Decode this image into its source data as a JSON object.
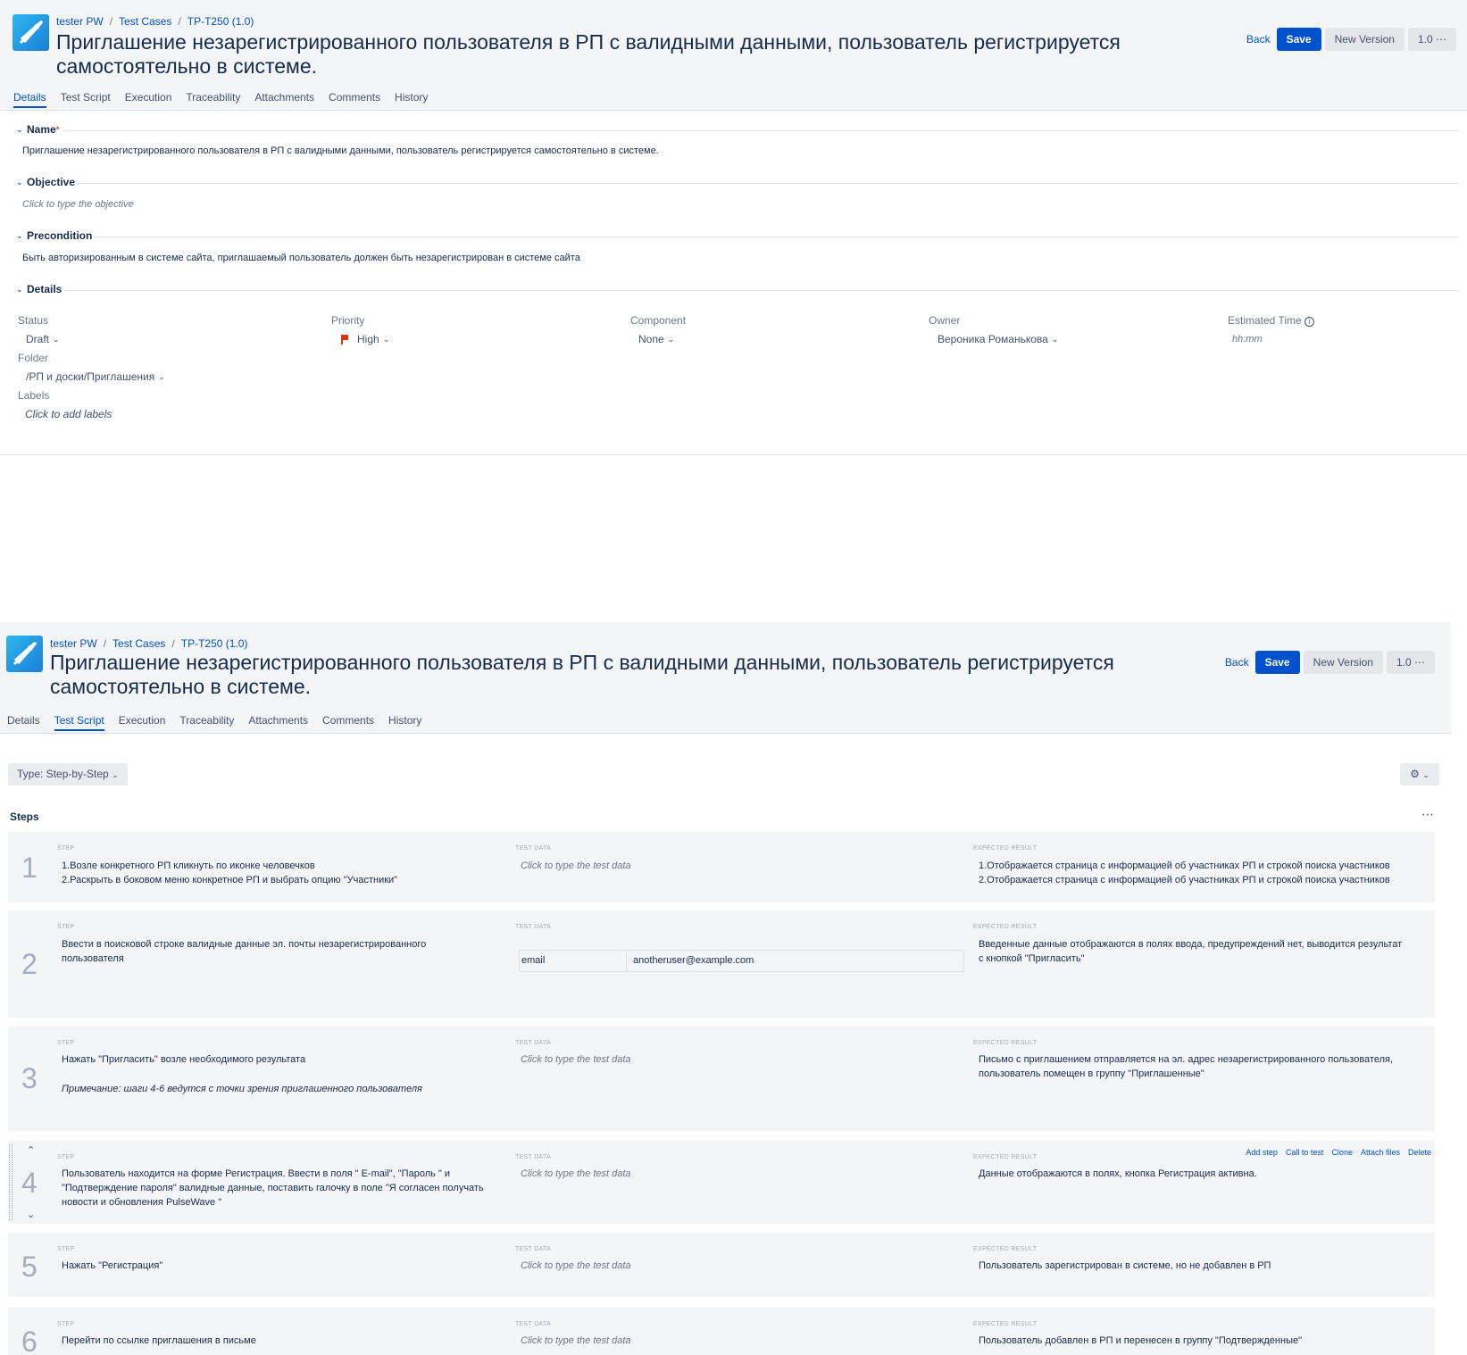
{
  "breadcrumb": {
    "project": "tester PW",
    "section": "Test Cases",
    "key": "TP-T250 (1.0)"
  },
  "title": "Приглашение незарегистрированного пользователя в РП с валидными данными, пользователь регистрируется самостоятельно в системе.",
  "actions": {
    "back": "Back",
    "save": "Save",
    "new_version": "New Version",
    "version": "1.0 ⋯"
  },
  "tabs": [
    "Details",
    "Test Script",
    "Execution",
    "Traceability",
    "Attachments",
    "Comments",
    "History"
  ],
  "details": {
    "name_label": "Name",
    "name_value": "Приглашение  незарегистрированного пользователя в РП с валидными данными, пользователь регистрируется самостоятельно в системе.",
    "objective_label": "Objective",
    "objective_placeholder": "Click to type the objective",
    "precondition_label": "Precondition",
    "precondition_value": "Быть авторизированным в системе сайта, приглашаемый пользователь должен быть незарегистрирован в системе сайта",
    "details_label": "Details",
    "fields": {
      "status_label": "Status",
      "status_value": "Draft",
      "priority_label": "Priority",
      "priority_value": "High",
      "component_label": "Component",
      "component_value": "None",
      "owner_label": "Owner",
      "owner_value": "Вероника Романькова",
      "estimated_label": "Estimated Time",
      "estimated_placeholder": "hh:mm",
      "folder_label": "Folder",
      "folder_value": "/РП и доски/Приглашения",
      "labels_label": "Labels",
      "labels_placeholder": "Click to add labels"
    }
  },
  "script": {
    "type_button": "Type: Step-by-Step",
    "steps_label": "Steps",
    "col_step": "STEP",
    "col_data": "TEST DATA",
    "col_result": "EXPECTED RESULT",
    "data_placeholder": "Click to type the test data",
    "step_actions": [
      "Add step",
      "Call to test",
      "Clone",
      "Attach files",
      "Delete"
    ],
    "steps": [
      {
        "n": "1",
        "step": [
          "1.Возле конкретного РП кликнуть по иконке человечков",
          "2.Раскрыть в боковом меню конкретное РП и выбрать опцию \"Участники\""
        ],
        "result": [
          "1.Отображается страница с информацией об участниках РП и строкой поиска участников",
          "2.Отображается страница с информацией об участниках РП и строкой поиска участников"
        ]
      },
      {
        "n": "2",
        "step": [
          "Ввести в поисковой строке валидные данные  эл. почты незарегистрированного",
          "пользователя"
        ],
        "data_key": "email",
        "data_value": "anotheruser@example.com",
        "result": [
          "Введенные данные отображаются в полях ввода, предупреждений нет, выводится результат",
          "с кнопкой \"Пригласить\""
        ]
      },
      {
        "n": "3",
        "step": [
          "Нажать \"Пригласить\" возле необходимого результата"
        ],
        "note": "Примечание: шаги 4-6 ведутся с точки зрения приглашенного пользователя",
        "result": [
          "Письмо с приглашением отправляется на эл. адрес незарегистрированного пользователя,",
          "пользователь помещен в группу \"Приглашенные\""
        ]
      },
      {
        "n": "4",
        "step": [
          "Пользователь находится на форме Регистрация. Ввести в поля  \" E-mail\", \"Пароль \" и",
          "\"Подтверждение пароля\" валидные данные, поставить галочку в поле \"Я согласен получать",
          "новости и обновления PulseWave \""
        ],
        "result": [
          "Данные отображаются в полях, кнопка Регистрация активна."
        ]
      },
      {
        "n": "5",
        "step": [
          "Нажать \"Регистрация\""
        ],
        "result": [
          "Пользователь зарегистрирован в системе, но не добавлен в РП"
        ]
      },
      {
        "n": "6",
        "step": [
          "Перейти по ссылке приглашения в письме"
        ],
        "result": [
          "Пользователь добавлен в РП и перенесен в группу \"Подтвержденные\""
        ]
      }
    ]
  },
  "colors": {
    "primary": "#0052cc",
    "header_bg": "#f4f5f7",
    "priority_flag": "#de350b"
  }
}
